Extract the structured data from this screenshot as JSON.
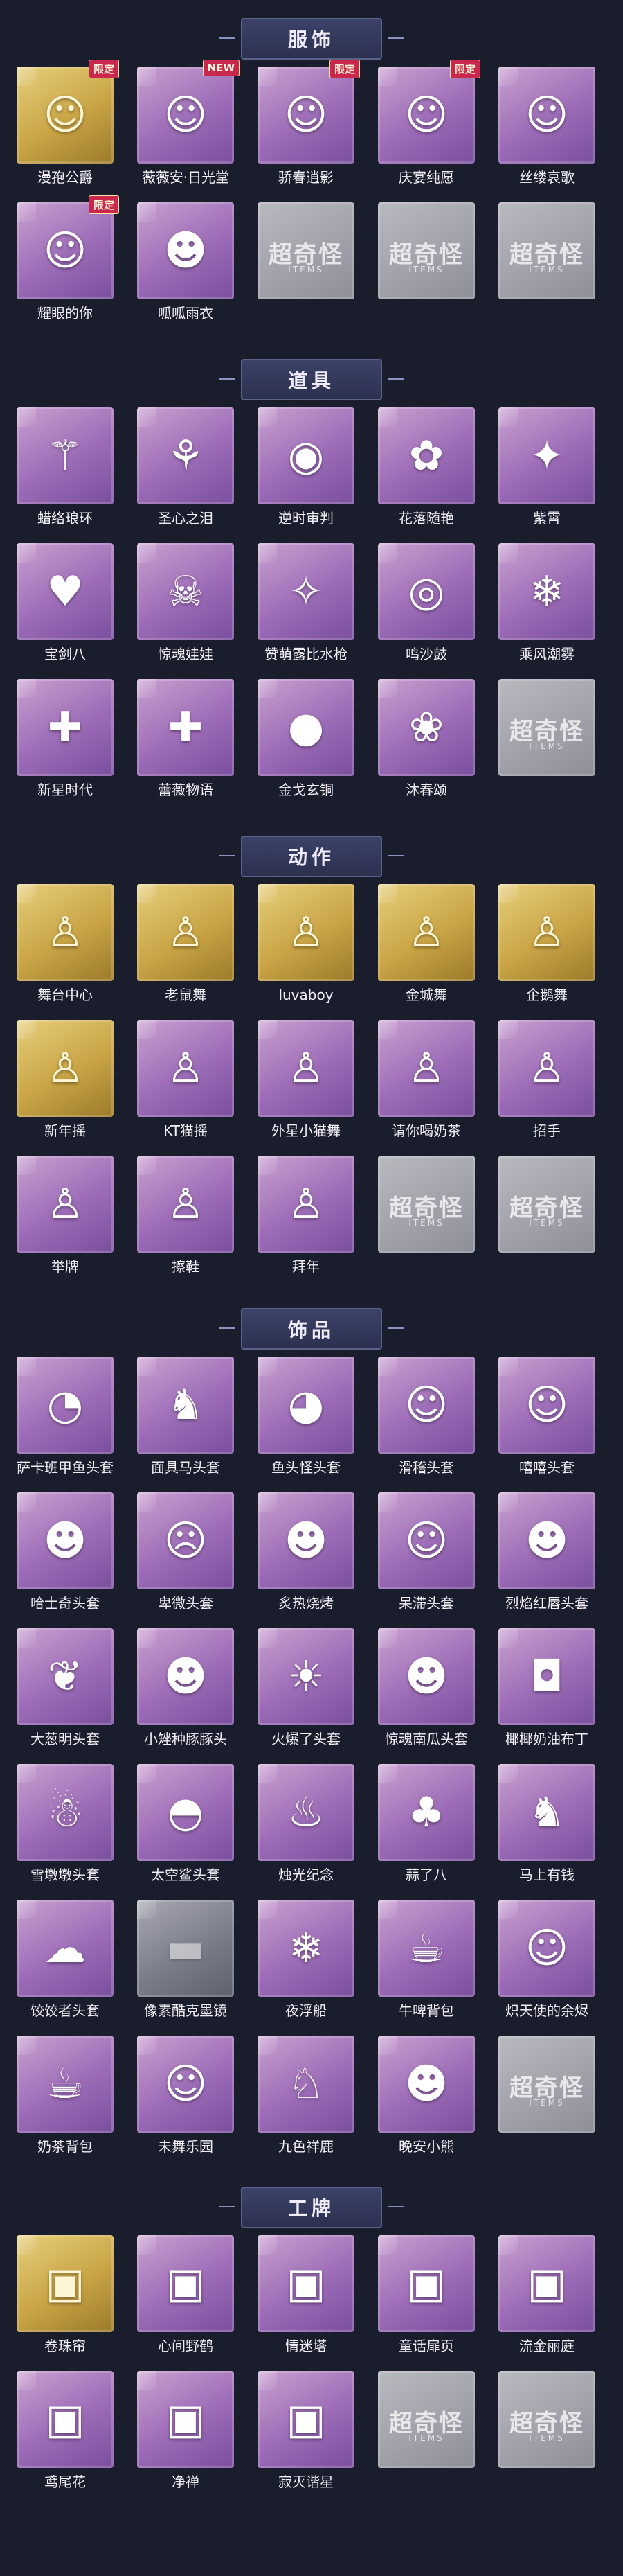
{
  "placeholder": {
    "text": "超奇怪",
    "sub": "ITEMS"
  },
  "sections": [
    {
      "key": "clothing",
      "title": "服饰",
      "items": [
        {
          "label": "漫孢公爵",
          "icon": "person-icon",
          "glyph": "☺",
          "rarity": "gold",
          "badge": "限定"
        },
        {
          "label": "薇薇安·日光堂",
          "icon": "person-icon",
          "glyph": "☺",
          "rarity": "purple",
          "badge": "NEW"
        },
        {
          "label": "骄春逍影",
          "icon": "person-icon",
          "glyph": "☺",
          "rarity": "purple",
          "badge": "限定"
        },
        {
          "label": "庆宴纯愿",
          "icon": "person-icon",
          "glyph": "☺",
          "rarity": "purple",
          "badge": "限定"
        },
        {
          "label": "丝缕哀歌",
          "icon": "person-icon",
          "glyph": "☺",
          "rarity": "purple",
          "badge": ""
        },
        {
          "label": "耀眼的你",
          "icon": "person-icon",
          "glyph": "☺",
          "rarity": "purple",
          "badge": "限定"
        },
        {
          "label": "呱呱雨衣",
          "icon": "frog-icon",
          "glyph": "☻",
          "rarity": "purple",
          "badge": ""
        },
        {
          "placeholder": true
        },
        {
          "placeholder": true
        },
        {
          "placeholder": true
        }
      ]
    },
    {
      "key": "props",
      "title": "道具",
      "items": [
        {
          "label": "蜡络琅环",
          "icon": "staff-icon",
          "glyph": "⚚",
          "rarity": "purple",
          "badge": ""
        },
        {
          "label": "圣心之泪",
          "icon": "scepter-icon",
          "glyph": "⚘",
          "rarity": "purple",
          "badge": ""
        },
        {
          "label": "逆时审判",
          "icon": "compass-icon",
          "glyph": "◉",
          "rarity": "purple",
          "badge": ""
        },
        {
          "label": "花落随艳",
          "icon": "flower-icon",
          "glyph": "✿",
          "rarity": "purple",
          "badge": ""
        },
        {
          "label": "紫霄",
          "icon": "wand-icon",
          "glyph": "✦",
          "rarity": "purple",
          "badge": ""
        },
        {
          "label": "宝剑八",
          "icon": "heart-icon",
          "glyph": "♥",
          "rarity": "purple",
          "badge": ""
        },
        {
          "label": "惊魂娃娃",
          "icon": "doll-icon",
          "glyph": "☠",
          "rarity": "purple",
          "badge": ""
        },
        {
          "label": "赞萌露比水枪",
          "icon": "water-gun-icon",
          "glyph": "✧",
          "rarity": "purple",
          "badge": ""
        },
        {
          "label": "鸣沙鼓",
          "icon": "drum-icon",
          "glyph": "◎",
          "rarity": "purple",
          "badge": ""
        },
        {
          "label": "乘风潮雾",
          "icon": "ship-icon",
          "glyph": "❄",
          "rarity": "purple",
          "badge": ""
        },
        {
          "label": "新星时代",
          "icon": "revolver-icon",
          "glyph": "✚",
          "rarity": "purple",
          "badge": ""
        },
        {
          "label": "蕾薇物语",
          "icon": "medkit-icon",
          "glyph": "✚",
          "rarity": "purple",
          "badge": ""
        },
        {
          "label": "金戈玄铜",
          "icon": "grenade-icon",
          "glyph": "●",
          "rarity": "purple",
          "badge": ""
        },
        {
          "label": "沐春颂",
          "icon": "branch-icon",
          "glyph": "❀",
          "rarity": "purple",
          "badge": ""
        },
        {
          "placeholder": true
        }
      ]
    },
    {
      "key": "actions",
      "title": "动作",
      "items": [
        {
          "label": "舞台中心",
          "icon": "pose-icon",
          "glyph": "♙",
          "rarity": "gold",
          "badge": ""
        },
        {
          "label": "老鼠舞",
          "icon": "pose-icon",
          "glyph": "♙",
          "rarity": "gold",
          "badge": ""
        },
        {
          "label": "luvaboy",
          "icon": "pose-icon",
          "glyph": "♙",
          "rarity": "gold",
          "badge": ""
        },
        {
          "label": "金城舞",
          "icon": "pose-icon",
          "glyph": "♙",
          "rarity": "gold",
          "badge": ""
        },
        {
          "label": "企鹅舞",
          "icon": "pose-icon",
          "glyph": "♙",
          "rarity": "gold",
          "badge": ""
        },
        {
          "label": "新年摇",
          "icon": "pose-icon",
          "glyph": "♙",
          "rarity": "gold",
          "badge": ""
        },
        {
          "label": "KT猫摇",
          "icon": "pose-icon",
          "glyph": "♙",
          "rarity": "purple",
          "badge": ""
        },
        {
          "label": "外星小猫舞",
          "icon": "pose-icon",
          "glyph": "♙",
          "rarity": "purple",
          "badge": ""
        },
        {
          "label": "请你喝奶茶",
          "icon": "pose-icon",
          "glyph": "♙",
          "rarity": "purple",
          "badge": ""
        },
        {
          "label": "招手",
          "icon": "pose-icon",
          "glyph": "♙",
          "rarity": "purple",
          "badge": ""
        },
        {
          "label": "举牌",
          "icon": "pose-icon",
          "glyph": "♙",
          "rarity": "purple",
          "badge": ""
        },
        {
          "label": "擦鞋",
          "icon": "pose-icon",
          "glyph": "♙",
          "rarity": "purple",
          "badge": ""
        },
        {
          "label": "拜年",
          "icon": "pose-icon",
          "glyph": "♙",
          "rarity": "purple",
          "badge": ""
        },
        {
          "placeholder": true
        },
        {
          "placeholder": true
        }
      ]
    },
    {
      "key": "accessories",
      "title": "饰品",
      "items": [
        {
          "label": "萨卡班甲鱼头套",
          "icon": "fish-icon",
          "glyph": "◔",
          "rarity": "purple",
          "badge": ""
        },
        {
          "label": "面具马头套",
          "icon": "horse-icon",
          "glyph": "♞",
          "rarity": "purple",
          "badge": ""
        },
        {
          "label": "鱼头怪头套",
          "icon": "fish-icon",
          "glyph": "◕",
          "rarity": "purple",
          "badge": ""
        },
        {
          "label": "滑稽头套",
          "icon": "smiley-icon",
          "glyph": "☺",
          "rarity": "purple",
          "badge": ""
        },
        {
          "label": "嘻嘻头套",
          "icon": "smiley-icon",
          "glyph": "☺",
          "rarity": "purple",
          "badge": ""
        },
        {
          "label": "哈士奇头套",
          "icon": "dog-icon",
          "glyph": "☻",
          "rarity": "purple",
          "badge": ""
        },
        {
          "label": "卑微头套",
          "icon": "smiley-icon",
          "glyph": "☹",
          "rarity": "purple",
          "badge": ""
        },
        {
          "label": "炙热烧烤",
          "icon": "bread-icon",
          "glyph": "☻",
          "rarity": "purple",
          "badge": ""
        },
        {
          "label": "呆滞头套",
          "icon": "smiley-icon",
          "glyph": "☺",
          "rarity": "purple",
          "badge": ""
        },
        {
          "label": "烈焰红唇头套",
          "icon": "pikachu-icon",
          "glyph": "☻",
          "rarity": "purple",
          "badge": ""
        },
        {
          "label": "大葱明头套",
          "icon": "leek-icon",
          "glyph": "❦",
          "rarity": "purple",
          "badge": ""
        },
        {
          "label": "小矬种豚豚头",
          "icon": "pig-icon",
          "glyph": "☻",
          "rarity": "purple",
          "badge": ""
        },
        {
          "label": "火爆了头套",
          "icon": "fire-icon",
          "glyph": "☀",
          "rarity": "purple",
          "badge": ""
        },
        {
          "label": "惊魂南瓜头套",
          "icon": "pumpkin-icon",
          "glyph": "☻",
          "rarity": "purple",
          "badge": ""
        },
        {
          "label": "椰椰奶油布丁",
          "icon": "pudding-icon",
          "glyph": "◘",
          "rarity": "purple",
          "badge": ""
        },
        {
          "label": "雪墩墩头套",
          "icon": "snowman-icon",
          "glyph": "☃",
          "rarity": "purple",
          "badge": ""
        },
        {
          "label": "太空鲨头套",
          "icon": "shark-icon",
          "glyph": "◓",
          "rarity": "purple",
          "badge": ""
        },
        {
          "label": "烛光纪念",
          "icon": "candle-icon",
          "glyph": "♨",
          "rarity": "purple",
          "badge": ""
        },
        {
          "label": "蒜了八",
          "icon": "garlic-icon",
          "glyph": "♣",
          "rarity": "purple",
          "badge": ""
        },
        {
          "label": "马上有钱",
          "icon": "horse-icon",
          "glyph": "♞",
          "rarity": "purple",
          "badge": ""
        },
        {
          "label": "饺饺者头套",
          "icon": "dumpling-icon",
          "glyph": "☁",
          "rarity": "purple",
          "badge": ""
        },
        {
          "label": "像素酷克墨镜",
          "icon": "sunglasses-icon",
          "glyph": "▬",
          "rarity": "gray",
          "badge": ""
        },
        {
          "label": "夜浮船",
          "icon": "lantern-icon",
          "glyph": "❄",
          "rarity": "purple",
          "badge": ""
        },
        {
          "label": "牛啤背包",
          "icon": "backpack-icon",
          "glyph": "☕",
          "rarity": "purple",
          "badge": ""
        },
        {
          "label": "炽天使的余烬",
          "icon": "doll-icon",
          "glyph": "☺",
          "rarity": "purple",
          "badge": ""
        },
        {
          "label": "奶茶背包",
          "icon": "backpack-icon",
          "glyph": "☕",
          "rarity": "purple",
          "badge": ""
        },
        {
          "label": "未舞乐园",
          "icon": "doll-icon",
          "glyph": "☺",
          "rarity": "purple",
          "badge": ""
        },
        {
          "label": "九色祥鹿",
          "icon": "deer-icon",
          "glyph": "♘",
          "rarity": "purple",
          "badge": ""
        },
        {
          "label": "晚安小熊",
          "icon": "bear-icon",
          "glyph": "☻",
          "rarity": "purple",
          "badge": ""
        },
        {
          "placeholder": true
        }
      ]
    },
    {
      "key": "badges",
      "title": "工牌",
      "items": [
        {
          "label": "卷珠帘",
          "icon": "card-icon",
          "glyph": "▣",
          "rarity": "gold",
          "badge": ""
        },
        {
          "label": "心间野鹤",
          "icon": "card-icon",
          "glyph": "▣",
          "rarity": "purple",
          "badge": ""
        },
        {
          "label": "情迷塔",
          "icon": "card-icon",
          "glyph": "▣",
          "rarity": "purple",
          "badge": ""
        },
        {
          "label": "童话扉页",
          "icon": "card-icon",
          "glyph": "▣",
          "rarity": "purple",
          "badge": ""
        },
        {
          "label": "流金丽庭",
          "icon": "card-icon",
          "glyph": "▣",
          "rarity": "purple",
          "badge": ""
        },
        {
          "label": "鸢尾花",
          "icon": "card-icon",
          "glyph": "▣",
          "rarity": "purple",
          "badge": ""
        },
        {
          "label": "净禅",
          "icon": "card-icon",
          "glyph": "▣",
          "rarity": "purple",
          "badge": ""
        },
        {
          "label": "寂灭谐星",
          "icon": "card-icon",
          "glyph": "▣",
          "rarity": "purple",
          "badge": ""
        },
        {
          "placeholder": true
        },
        {
          "placeholder": true
        }
      ]
    }
  ]
}
